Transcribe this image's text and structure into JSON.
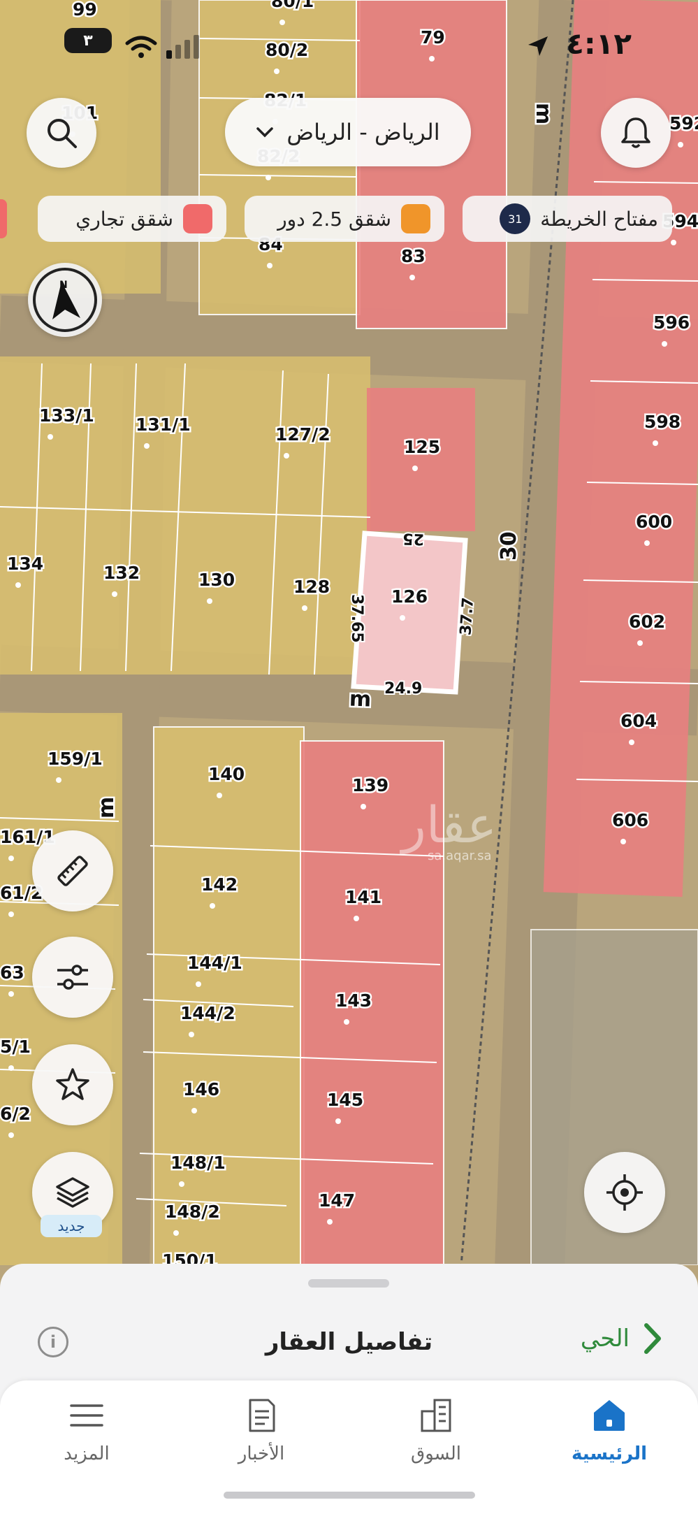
{
  "status_bar": {
    "battery": "٣",
    "time": "٤:١٢"
  },
  "header": {
    "city_label": "الرياض - الرياض"
  },
  "filter_chips": [
    {
      "label": "مفتاح الخريطة",
      "badge": "31"
    },
    {
      "label": "شقق 2.5 دور",
      "color": "#f0952a"
    },
    {
      "label": "شقق تجاري",
      "color": "#f06a6a"
    }
  ],
  "map": {
    "colors": {
      "residential": "#d7be6f",
      "commercial": "#e88080",
      "selected": "#f3c6c8",
      "ground": "#b9a57c"
    },
    "street_labels": [
      "m",
      "m",
      "m",
      "30"
    ],
    "plot_labels": [
      "99",
      "80/1",
      "80/2",
      "79",
      "82/1",
      "82/2",
      "84",
      "83",
      "101",
      "592",
      "594",
      "596",
      "598",
      "600",
      "602",
      "604",
      "606",
      "133/1",
      "131/1",
      "127/2",
      "125",
      "134",
      "132",
      "130",
      "128",
      "126",
      "159/1",
      "140",
      "139",
      "161/1",
      "142",
      "141",
      "61/2",
      "144/1",
      "143",
      "63",
      "144/2",
      "5/1",
      "146",
      "145",
      "6/2",
      "148/1",
      "148/2",
      "147",
      "150/1"
    ],
    "dimensions": {
      "top": "25",
      "left": "37.65",
      "right": "37.7",
      "bottom": "24.9"
    },
    "watermark": {
      "arabic": "عقار",
      "url": "sa.aqar.sa"
    }
  },
  "side_buttons": {
    "new_badge": "جديد"
  },
  "sheet": {
    "title": "تفاصيل العقار",
    "nav_label": "الحي"
  },
  "tabs": [
    {
      "label": "الرئيسية",
      "icon": "home-icon",
      "active": true
    },
    {
      "label": "السوق",
      "icon": "buildings-icon",
      "active": false
    },
    {
      "label": "الأخبار",
      "icon": "news-icon",
      "active": false
    },
    {
      "label": "المزيد",
      "icon": "menu-icon",
      "active": false
    }
  ]
}
